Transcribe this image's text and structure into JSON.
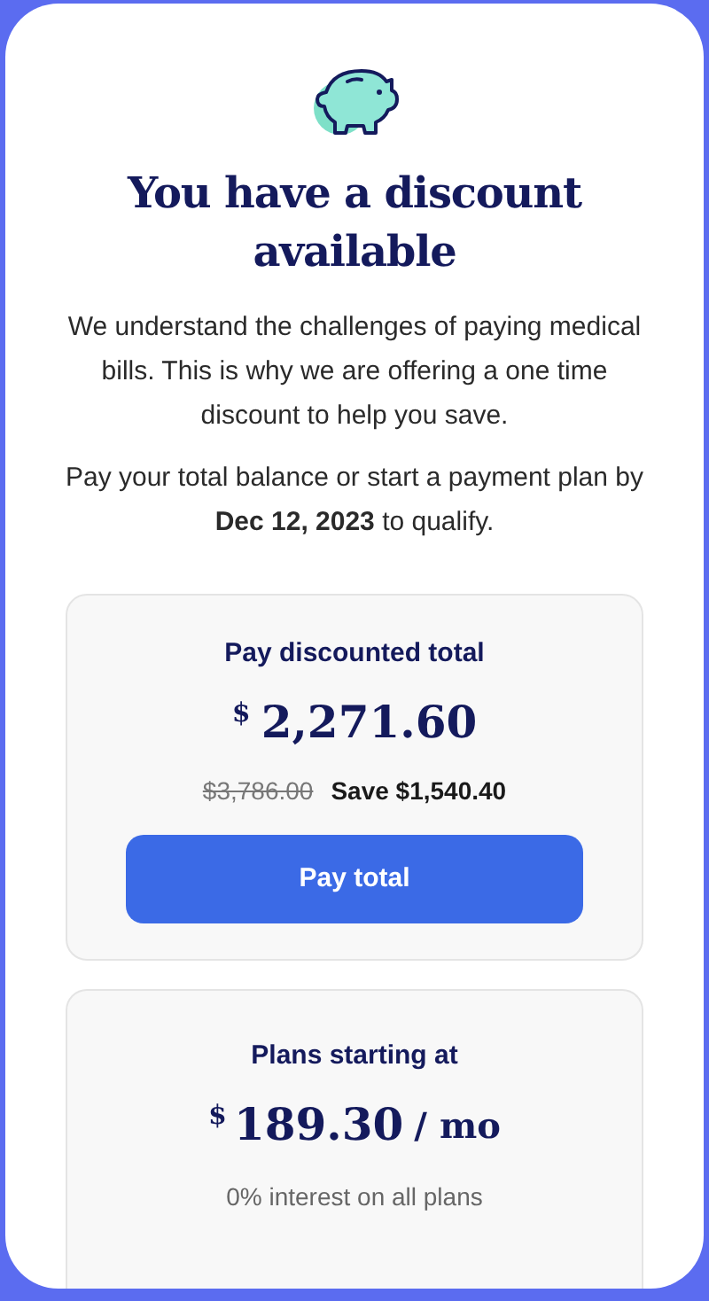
{
  "title": "You have a discount available",
  "intro": "We understand the challenges of paying medical bills. This is why we are offering a one time discount to help you save.",
  "deadline": "Pay your total balance or start a payment plan by **Dec 12, 2023** to qualify.",
  "discount_card": {
    "heading": "Pay discounted total",
    "currency": "$",
    "amount": "2,271.60",
    "original_price": "$3,786.00",
    "savings": "Save $1,540.40",
    "button": "Pay total"
  },
  "plans_card": {
    "heading": "Plans starting at",
    "currency": "$",
    "amount": "189.30",
    "period": "/ mo",
    "note": "0% interest on all plans"
  }
}
